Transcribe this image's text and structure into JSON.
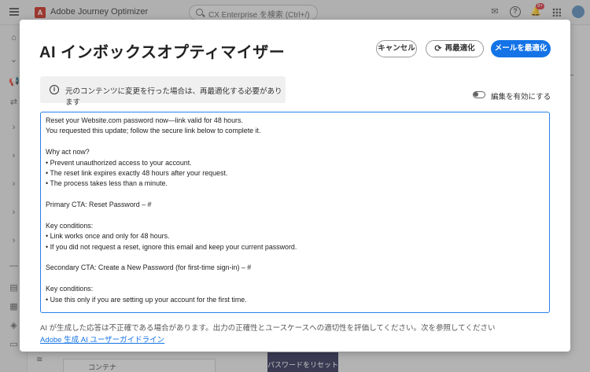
{
  "app": {
    "logo_letter": "A",
    "title": "Adobe Journey Optimizer",
    "search_placeholder": "CX Enterprise を検索 (Ctrl+/)",
    "notification_badge": "9+"
  },
  "background": {
    "reset_button_label": "パスワードをリセット",
    "container_label": "コンテナ"
  },
  "modal": {
    "title": "AI インボックスオプティマイザー",
    "cancel_label": "キャンセル",
    "reoptimize_label": "再最適化",
    "optimize_label": "メールを最適化",
    "info_text": "元のコンテンツに変更を行った場合は、再最適化する必要があります",
    "toggle_label": "編集を有効にする",
    "editor_lines": [
      "Reset your Website.com password now—link valid for 48 hours.",
      "You requested this update; follow the secure link below to complete it.",
      "",
      "Why act now?",
      "• Prevent unauthorized access to your account.",
      "• The reset link expires exactly 48 hours after your request.",
      "• The process takes less than a minute.",
      "",
      "Primary CTA: Reset Password – #",
      "",
      "Key conditions:",
      "• Link works once and only for 48 hours.",
      "• If you did not request a reset, ignore this email and keep your current password.",
      "",
      "Secondary CTA: Create a New Password (for first-time sign-in) – #",
      "",
      "Key conditions:",
      "• Use this only if you are setting up your account for the first time."
    ],
    "disclaimer": "AI が生成した応答は不正確である場合があります。出力の正確性とユースケースへの適切性を評価してください。次を参照してください",
    "guide_link": "Adobe 生成 AI ユーザーガイドライン"
  }
}
